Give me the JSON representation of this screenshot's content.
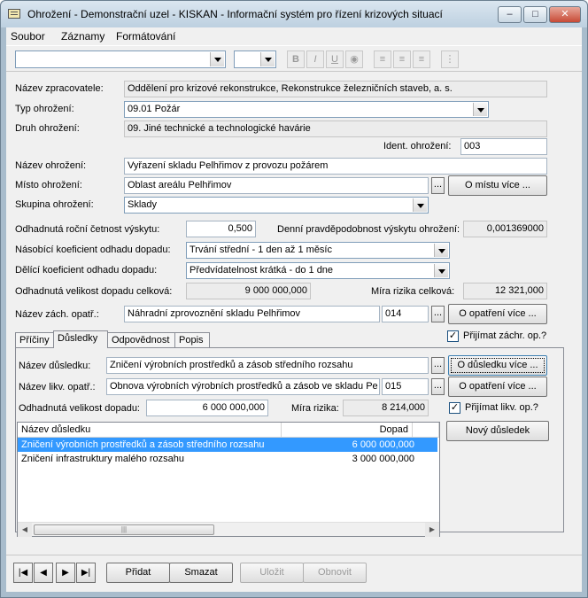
{
  "window": {
    "title": "Ohrožení - Demonstrační uzel - KISKAN - Informační systém pro řízení krizových situací"
  },
  "menu": [
    "Soubor",
    "Záznamy",
    "Formátování"
  ],
  "toolbar": {
    "bold": "B",
    "italic": "I",
    "underline": "U"
  },
  "form": {
    "processor_label": "Název zpracovatele:",
    "processor_value": "Oddělení pro krizové rekonstrukce, Rekonstrukce železničních staveb, a. s.",
    "type_label": "Typ ohrožení:",
    "type_value": "09.01 Požár",
    "kind_label": "Druh ohrožení:",
    "kind_value": "09. Jiné technické a technologické havárie",
    "ident_label": "Ident. ohrožení:",
    "ident_value": "003",
    "name_label": "Název ohrožení:",
    "name_value": "Vyřazení skladu Pelhřimov z provozu požárem",
    "place_label": "Místo ohrožení:",
    "place_value": "Oblast areálu Pelhřimov",
    "place_more_button": "O místu více ...",
    "group_label": "Skupina ohrožení:",
    "group_value": "Sklady",
    "frequency_label": "Odhadnutá roční četnost výskytu:",
    "frequency_value": "0,500",
    "daily_prob_label": "Denní pravděpodobnost výskytu ohrožení:",
    "daily_prob_value": "0,001369000",
    "multiplier_label": "Násobící koeficient odhadu dopadu:",
    "multiplier_value": "Trvání střední - 1 den až 1 měsíc",
    "divisor_label": "Dělící koeficient odhadu dopadu:",
    "divisor_value": "Předvídatelnost krátká - do 1 dne",
    "impact_total_label": "Odhadnutá velikost dopadu celková:",
    "impact_total_value": "9 000 000,000",
    "risk_total_label": "Míra rizika celková:",
    "risk_total_value": "12 321,000",
    "measure_label": "Název zách. opatř.:",
    "measure_value": "Náhradní zprovoznění skladu Pelhřimov",
    "measure_code": "014",
    "measure_more_button": "O opatření více ...",
    "accept_measure_label": "Přijímat záchr. op.?",
    "accept_measure_checked": "✓"
  },
  "tabs": [
    "Příčiny",
    "Důsledky",
    "Odpovědnost",
    "Popis"
  ],
  "consequence": {
    "name_label": "Název důsledku:",
    "name_value": "Zničení výrobních prostředků a zásob středního rozsahu",
    "more_button": "O důsledku více ...",
    "liq_label": "Název likv. opatř.:",
    "liq_value": "Obnova výrobních výrobních prostředků a zásob ve skladu Pe",
    "liq_code": "015",
    "liq_more_button": "O opatření více ...",
    "impact_label": "Odhadnutá velikost dopadu:",
    "impact_value": "6 000 000,000",
    "risk_label": "Míra rizika:",
    "risk_value": "8 214,000",
    "accept_liq_label": "Přijímat likv. op.?",
    "accept_liq_checked": "✓",
    "new_button": "Nový důsledek"
  },
  "grid": {
    "columns": [
      "Název důsledku",
      "Dopad"
    ],
    "rows": [
      {
        "name": "Zničení výrobních prostředků a zásob středního rozsahu",
        "impact": "6 000 000,000",
        "selected": true
      },
      {
        "name": "Zničení infrastruktury malého rozsahu",
        "impact": "3 000 000,000",
        "selected": false
      }
    ]
  },
  "nav": {
    "add": "Přidat",
    "delete": "Smazat",
    "save": "Uložit",
    "refresh": "Obnovit"
  }
}
